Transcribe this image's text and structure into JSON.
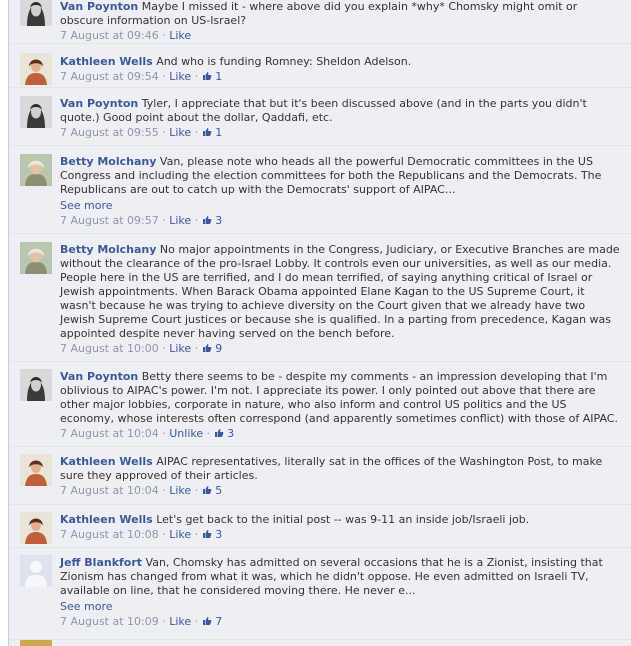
{
  "sep": "·",
  "comments": [
    {
      "author": "Van Poynton",
      "text": "Maybe I missed it - where above did you explain *why* Chomsky might omit or obscure information on US-Israel?",
      "time": "7 August at 09:46",
      "like": "Like",
      "likes": "",
      "avatar": "van-poynton-avatar"
    },
    {
      "author": "Kathleen Wells",
      "text": "And who is funding Romney: Sheldon Adelson.",
      "time": "7 August at 09:54",
      "like": "Like",
      "likes": "1",
      "avatar": "kathleen-wells-avatar"
    },
    {
      "author": "Van Poynton",
      "text": "Tyler, I appreciate that but it's been discussed above (and in the parts you didn't quote.) Good point about the dollar, Qaddafi, etc.",
      "time": "7 August at 09:55",
      "like": "Like",
      "likes": "1",
      "avatar": "van-poynton-avatar"
    },
    {
      "author": "Betty Molchany",
      "text": "Van, please note who heads all the powerful Democratic committees in the US Congress and including the election committees for both the Republicans and the Democrats. The Republicans are out to catch up with the Democrats' support of AIPAC...",
      "see_more": "See more",
      "time": "7 August at 09:57",
      "like": "Like",
      "likes": "3",
      "avatar": "betty-molchany-avatar"
    },
    {
      "author": "Betty Molchany",
      "text": "No major appointments in the Congress, Judiciary, or Executive Branches are made without the clearance of the pro-Israel Lobby. It controls even our universities, as well as our media. People here in the US are terrified, and I do mean terrified, of saying anything critical of Israel or Jewish appointments. When Barack Obama appointed Elane Kagan to the US Supreme Court, it wasn't because he was trying to achieve diversity on the Court given that we already have two Jewish Supreme Court justices or because she is qualified. In a parting from precedence, Kagan was appointed despite never having served on the bench before.",
      "time": "7 August at 10:00",
      "like": "Like",
      "likes": "9",
      "avatar": "betty-molchany-avatar"
    },
    {
      "author": "Van Poynton",
      "text": "Betty there seems to be - despite my comments - an impression developing that I'm oblivious to AIPAC's power. I'm not. I appreciate its power. I only pointed out above that there are other major lobbies, corporate in nature, who also inform and control US politics and the US economy, whose interests often correspond (and apparently sometimes conflict) with those of AIPAC.",
      "time": "7 August at 10:04",
      "like": "Unlike",
      "likes": "3",
      "avatar": "van-poynton-avatar"
    },
    {
      "author": "Kathleen Wells",
      "text": "AIPAC representatives, literally sat in the offices of the Washington Post, to make sure they approved of their articles.",
      "time": "7 August at 10:04",
      "like": "Like",
      "likes": "5",
      "avatar": "kathleen-wells-avatar"
    },
    {
      "author": "Kathleen Wells",
      "text": "Let's get back to the initial post -- was 9-11 an inside job/Israeli job.",
      "time": "7 August at 10:08",
      "like": "Like",
      "likes": "3",
      "avatar": "kathleen-wells-avatar"
    },
    {
      "author": "Jeff Blankfort",
      "text": "Van, Chomsky has admitted on several occasions that he is a Zionist, insisting that Zionism has changed from what it was, which he didn't oppose. He even admitted on Israeli TV, available on line, that he considered moving there. He never e...",
      "see_more": "See more",
      "time": "7 August at 10:09",
      "like": "Like",
      "likes": "7",
      "avatar": "default-user-avatar"
    }
  ]
}
